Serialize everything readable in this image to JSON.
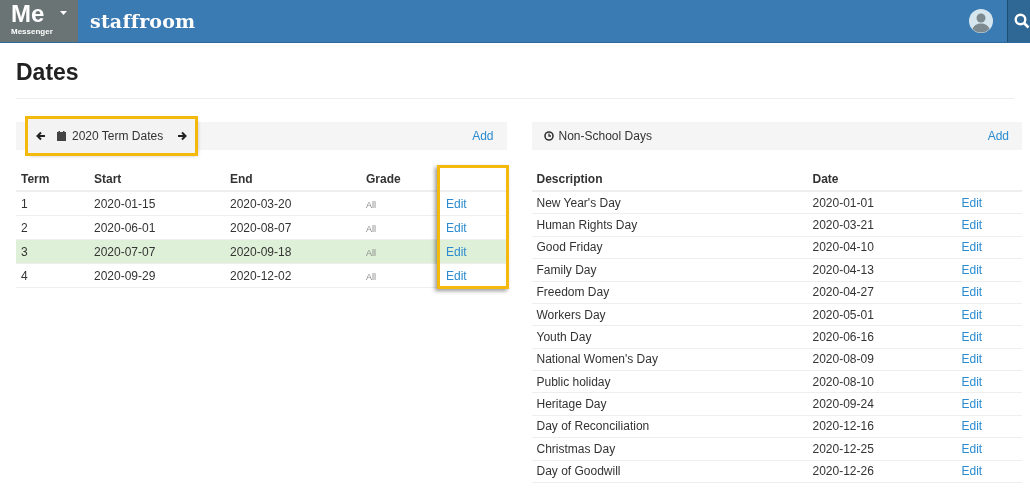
{
  "header": {
    "app_badge": {
      "short": "Me",
      "name": "Messenger"
    },
    "brand": "staffroom"
  },
  "page_title": "Dates",
  "term_dates": {
    "nav": {
      "label": "2020 Term Dates",
      "highlighted": true
    },
    "add": "Add",
    "edit_column_highlighted": true,
    "columns": [
      "Term",
      "Start",
      "End",
      "Grade"
    ],
    "rows": [
      {
        "term": "1",
        "start": "2020-01-15",
        "end": "2020-03-20",
        "grade": "All",
        "action": "Edit",
        "selected": false
      },
      {
        "term": "2",
        "start": "2020-06-01",
        "end": "2020-08-07",
        "grade": "All",
        "action": "Edit",
        "selected": false
      },
      {
        "term": "3",
        "start": "2020-07-07",
        "end": "2020-09-18",
        "grade": "All",
        "action": "Edit",
        "selected": true
      },
      {
        "term": "4",
        "start": "2020-09-29",
        "end": "2020-12-02",
        "grade": "All",
        "action": "Edit",
        "selected": false
      }
    ]
  },
  "non_school_days": {
    "title": "Non-School Days",
    "add": "Add",
    "columns": [
      "Description",
      "Date"
    ],
    "rows": [
      {
        "description": "New Year's Day",
        "date": "2020-01-01",
        "action": "Edit"
      },
      {
        "description": "Human Rights Day",
        "date": "2020-03-21",
        "action": "Edit"
      },
      {
        "description": "Good Friday",
        "date": "2020-04-10",
        "action": "Edit"
      },
      {
        "description": "Family Day",
        "date": "2020-04-13",
        "action": "Edit"
      },
      {
        "description": "Freedom Day",
        "date": "2020-04-27",
        "action": "Edit"
      },
      {
        "description": "Workers Day",
        "date": "2020-05-01",
        "action": "Edit"
      },
      {
        "description": "Youth Day",
        "date": "2020-06-16",
        "action": "Edit"
      },
      {
        "description": "National Women's Day",
        "date": "2020-08-09",
        "action": "Edit"
      },
      {
        "description": "Public holiday",
        "date": "2020-08-10",
        "action": "Edit"
      },
      {
        "description": "Heritage Day",
        "date": "2020-09-24",
        "action": "Edit"
      },
      {
        "description": "Day of Reconciliation",
        "date": "2020-12-16",
        "action": "Edit"
      },
      {
        "description": "Christmas Day",
        "date": "2020-12-25",
        "action": "Edit"
      },
      {
        "description": "Day of Goodwill",
        "date": "2020-12-26",
        "action": "Edit"
      }
    ]
  }
}
